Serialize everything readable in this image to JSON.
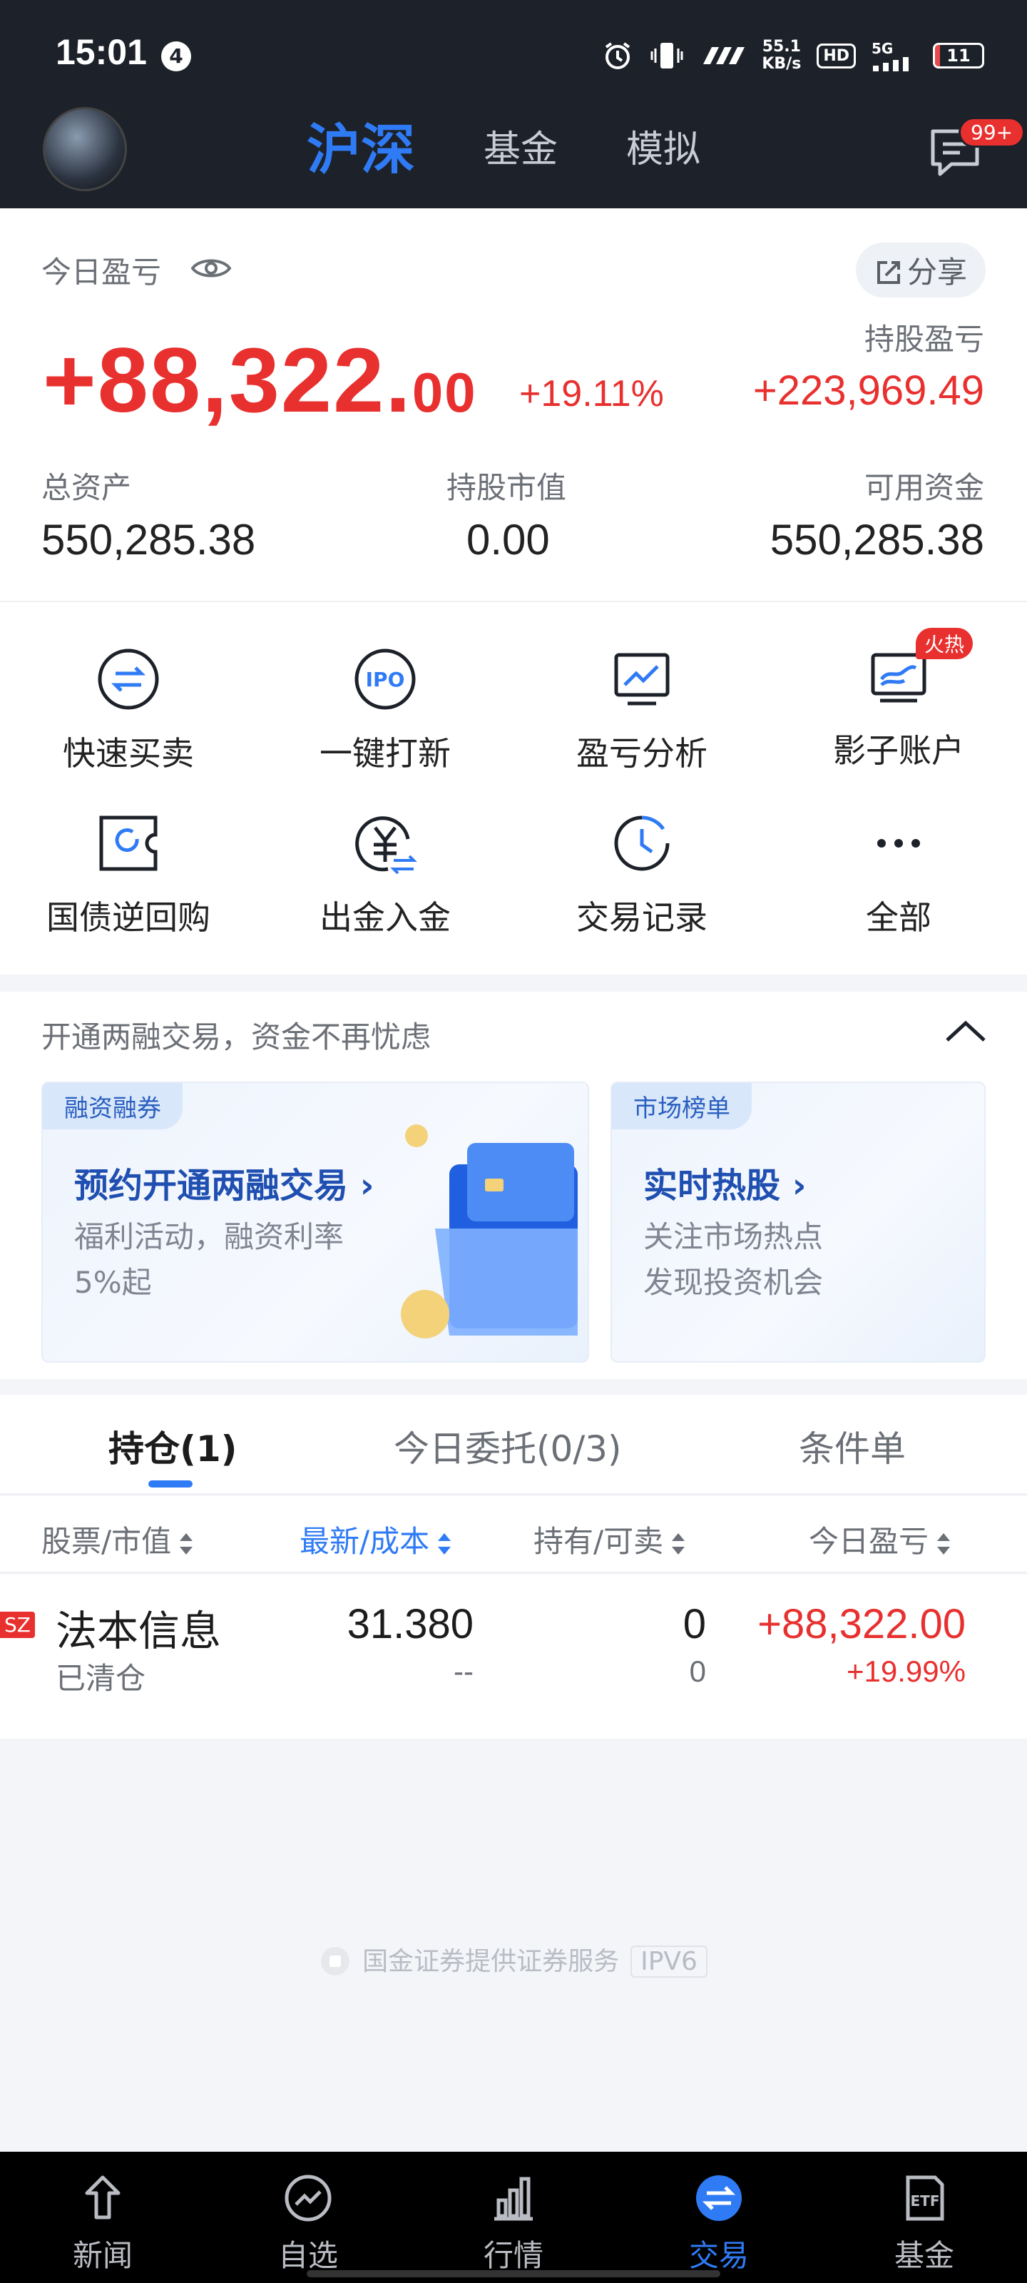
{
  "status_bar": {
    "time": "15:01",
    "notification_count": "4",
    "net_speed": "55.1",
    "net_unit": "KB/s",
    "hd": "HD",
    "signal": "5G",
    "battery": "11",
    "battery_level": 0.11
  },
  "header": {
    "tabs": [
      "沪深",
      "基金",
      "模拟"
    ],
    "active_tab": "沪深",
    "message_badge": "99+"
  },
  "summary": {
    "today_pl_label": "今日盈亏",
    "share_label": "分享",
    "today_pl_main": "+88,322.",
    "today_pl_decimal": "00",
    "today_pl_pct": "+19.11%",
    "holding_pl_label": "持股盈亏",
    "holding_pl_value": "+223,969.49",
    "total_assets_label": "总资产",
    "total_assets_value": "550,285.38",
    "market_value_label": "持股市值",
    "market_value_value": "0.00",
    "available_label": "可用资金",
    "available_value": "550,285.38"
  },
  "quick_actions": [
    {
      "label": "快速买卖",
      "icon": "swap-icon"
    },
    {
      "label": "一键打新",
      "icon": "ipo-icon"
    },
    {
      "label": "盈亏分析",
      "icon": "chart-monitor-icon"
    },
    {
      "label": "影子账户",
      "icon": "shadow-account-icon",
      "badge": "火热"
    },
    {
      "label": "国债逆回购",
      "icon": "bond-repo-icon"
    },
    {
      "label": "出金入金",
      "icon": "yuan-transfer-icon"
    },
    {
      "label": "交易记录",
      "icon": "clock-icon"
    },
    {
      "label": "全部",
      "icon": "more-icon"
    }
  ],
  "promo": {
    "header": "开通两融交易，资金不再忧虑",
    "cards": [
      {
        "tag": "融资融券",
        "title": "预约开通两融交易",
        "line1": "福利活动，融资利率",
        "line2": "5%起"
      },
      {
        "tag": "市场榜单",
        "title": "实时热股",
        "line1": "关注市场热点",
        "line2": "发现投资机会"
      }
    ]
  },
  "position_tabs": {
    "holdings": "持仓(1)",
    "orders": "今日委托(0/3)",
    "conditional": "条件单"
  },
  "table": {
    "headers": [
      "股票/市值",
      "最新/成本",
      "持有/可卖",
      "今日盈亏"
    ],
    "rows": [
      {
        "market": "SZ",
        "name": "法本信息",
        "status": "已清仓",
        "latest": "31.380",
        "cost": "--",
        "hold": "0",
        "sellable": "0",
        "pl": "+88,322.00",
        "pl_pct": "+19.99%"
      }
    ]
  },
  "footer": {
    "text": "国金证券提供证券服务",
    "ipv": "IPV6"
  },
  "bottom_nav": [
    {
      "label": "新闻",
      "icon": "news-icon"
    },
    {
      "label": "自选",
      "icon": "watchlist-icon"
    },
    {
      "label": "行情",
      "icon": "market-icon"
    },
    {
      "label": "交易",
      "icon": "trade-icon"
    },
    {
      "label": "基金",
      "icon": "fund-etf-icon"
    }
  ],
  "colors": {
    "accent": "#2f7bf5",
    "gain": "#e8302f",
    "header_bg": "#1d2129"
  }
}
